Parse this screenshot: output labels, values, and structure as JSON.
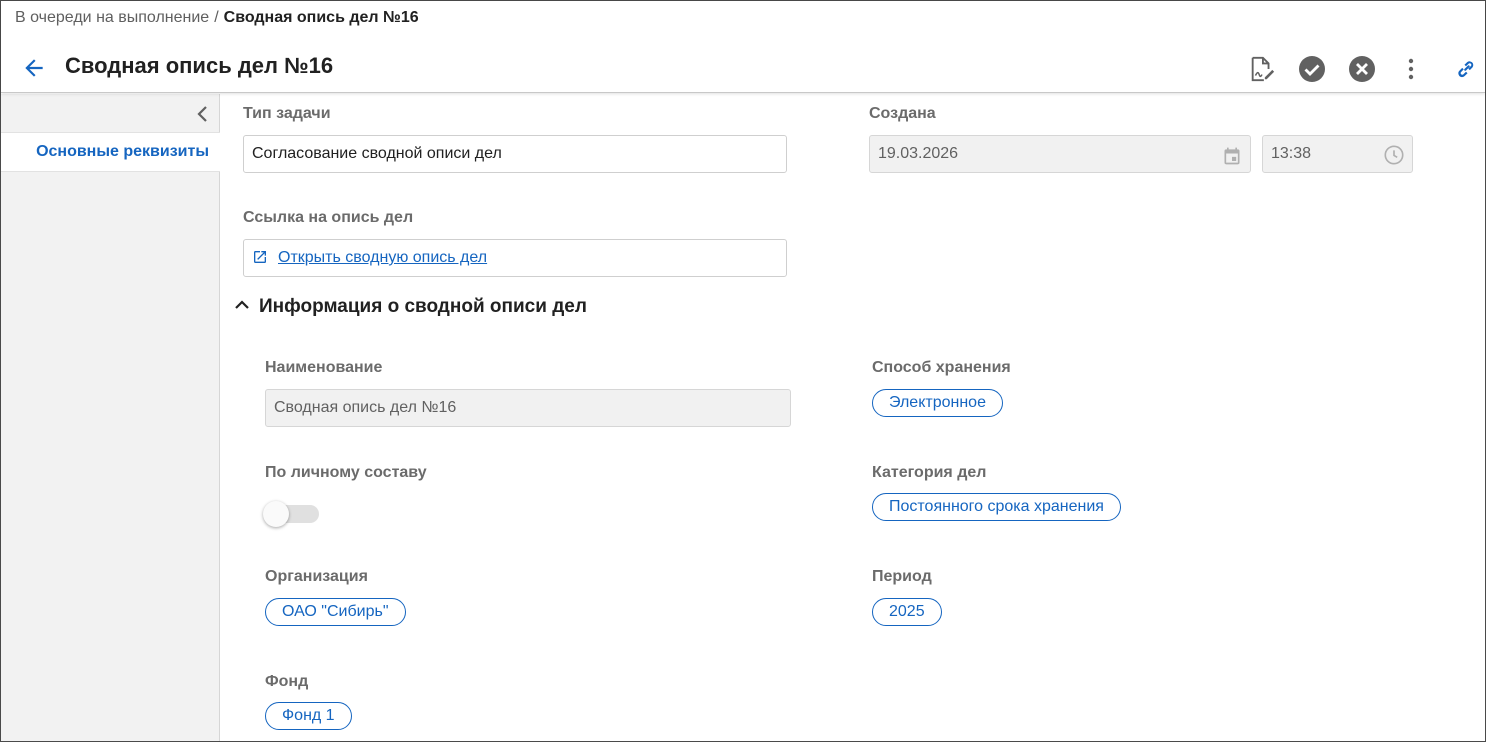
{
  "breadcrumb": {
    "parent": "В очереди на выполнение",
    "separator": "/",
    "current": "Сводная опись дел №16"
  },
  "header": {
    "title": "Сводная опись дел №16",
    "icons": [
      "back-arrow-icon",
      "sign-document-icon",
      "approve-check-icon",
      "reject-x-icon",
      "more-vert-icon",
      "link-icon"
    ]
  },
  "sidebar": {
    "items": [
      {
        "label": "Основные реквизиты",
        "active": true
      }
    ]
  },
  "form": {
    "task_type": {
      "label": "Тип задачи",
      "value": "Согласование сводной описи дел"
    },
    "created": {
      "label": "Создана",
      "date": "19.03.2026",
      "time": "13:38"
    },
    "link": {
      "label": "Ссылка на опись дел",
      "text": "Открыть сводную опись дел"
    }
  },
  "section": {
    "title": "Информация о сводной описи дел",
    "expanded": true,
    "name": {
      "label": "Наименование",
      "value": "Сводная опись дел №16"
    },
    "storage_method": {
      "label": "Способ хранения",
      "value": "Электронное"
    },
    "personnel": {
      "label": "По личному составу",
      "enabled": false
    },
    "category": {
      "label": "Категория дел",
      "value": "Постоянного срока хранения"
    },
    "organization": {
      "label": "Организация",
      "value": "ОАО \"Сибирь\""
    },
    "period": {
      "label": "Период",
      "value": "2025"
    },
    "fund": {
      "label": "Фонд",
      "value": "Фонд 1"
    }
  },
  "colors": {
    "accent": "#1565c0",
    "icon_gray": "#616161",
    "sidebar_bg": "#f2f2f2",
    "disabled_bg": "#f1f1f1"
  }
}
